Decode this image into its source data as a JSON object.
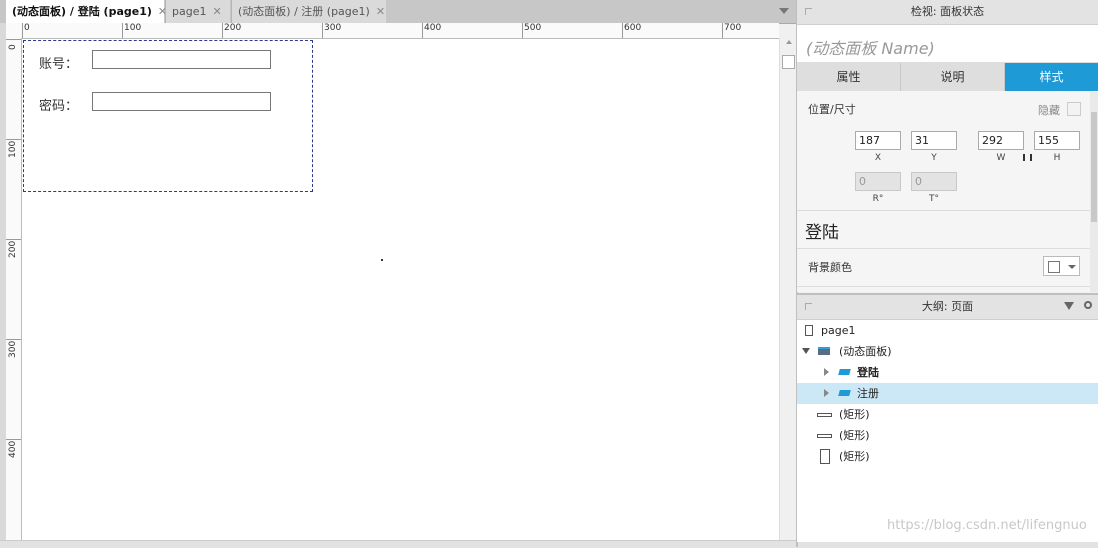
{
  "tabs": [
    {
      "label": "(动态面板) / 登陆 (page1)",
      "close": "✕",
      "active": true
    },
    {
      "label": "page1",
      "close": "✕",
      "active": false
    },
    {
      "label": "(动态面板) / 注册 (page1)",
      "close": "✕",
      "active": false
    }
  ],
  "ruler": {
    "top_labels": [
      "0",
      "100",
      "200",
      "300",
      "400",
      "500",
      "600",
      "700"
    ],
    "left_labels": [
      "0",
      "100",
      "200",
      "300",
      "400"
    ]
  },
  "canvas": {
    "account_label": "账号：",
    "password_label": "密码：",
    "account_value": "",
    "password_value": ""
  },
  "inspector": {
    "title": "检视: 面板状态",
    "name_placeholder": "(动态面板 Name)",
    "tabs": [
      "属性",
      "说明",
      "样式"
    ],
    "active_tab": "样式",
    "position_size_label": "位置/尺寸",
    "hide_label": "隐藏",
    "x": "187",
    "y": "31",
    "w": "292",
    "h": "155",
    "x_cap": "X",
    "y_cap": "Y",
    "w_cap": "W",
    "h_cap": "H",
    "r": "0",
    "t": "0",
    "r_cap": "R°",
    "t_cap": "T°",
    "state_name": "登陆",
    "bg_color_label": "背景颜色"
  },
  "outline": {
    "title": "大纲: 页面",
    "items": [
      {
        "label": "page1",
        "icon": "page-icon"
      },
      {
        "label": "(动态面板)",
        "icon": "dynamic-panel-icon"
      },
      {
        "label": "登陆",
        "icon": "panel-state-icon"
      },
      {
        "label": "注册",
        "icon": "panel-state-icon"
      },
      {
        "label": "(矩形)",
        "icon": "rectangle-icon"
      },
      {
        "label": "(矩形)",
        "icon": "rectangle-icon"
      },
      {
        "label": "(矩形)",
        "icon": "rectangle-icon"
      }
    ]
  },
  "watermark": "https://blog.csdn.net/lifengnuo",
  "colors": {
    "accent": "#1e9ad6",
    "selection": "#cce8f6",
    "panel_border": "#2b3a8c"
  }
}
